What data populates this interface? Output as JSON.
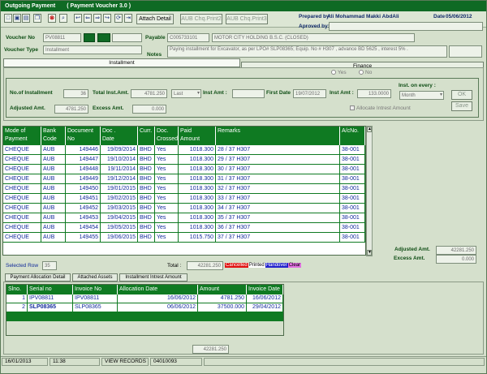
{
  "titlebar": {
    "app": "Outgoing Payment",
    "voucher_kind": "( Payment Voucher 3.0 )"
  },
  "toolbar": {
    "icons": [
      "new-icon",
      "save-icon",
      "print-icon",
      "copy-icon",
      "delete-icon",
      "find-icon",
      "first-icon",
      "previous-icon",
      "next-icon",
      "last-icon",
      "refresh-icon",
      "exit-icon"
    ],
    "attach_detail": "Attach Detail",
    "chq_print_1": "AUB Chq.Print2",
    "chq_print_2": "AUB Chq.Print3"
  },
  "header": {
    "prepared_by_label": "Prepared by:",
    "prepared_by": "Ali Mohammad Makki AbdAli",
    "approved_by_label": "Aproved by:",
    "date_label": "Date",
    "date": "05/06/2012"
  },
  "voucher": {
    "voucher_no_label": "Voucher No",
    "voucher_no": "PV08811",
    "payable_label": "Payable",
    "payable_code": "C005733101",
    "payable_name": "MOTOR CITY HOLDING B.S.C. (CLOSED)",
    "voucher_type_label": "Voucher Type",
    "voucher_type": "Installment",
    "notes_label": "Notes",
    "notes": "Paying installment for Excavator, as per LPO# SLP08365; Equip. No # H307 , advance BD 5625 , interest 5% ."
  },
  "tabs": {
    "installment": "Installment",
    "finance": "Finance"
  },
  "finance": {
    "yes": "Yes",
    "no": "No"
  },
  "installment": {
    "no_of_installment_label": "No.of Installment",
    "no_of_installment": "36",
    "total_inst_amt_label": "Total Inst.Amt.",
    "total_inst_amt": "4781.250",
    "period": "Last",
    "inst_amount_label": "Inst Amt :",
    "first_date_label": "First Date",
    "first_date": "19/07/2012",
    "inst_amt2_label": "Inst Amt :",
    "inst_amt2": "133.0000",
    "inst_every_label": "Inst. on every :",
    "inst_every": "Month",
    "ok": "OK",
    "save": "Save",
    "adjusted_amt_label": "Adjusted Amt.",
    "adjusted_amt": "4781.250",
    "excess_amt_label": "Excess Amt.",
    "excess_amt": "0.000",
    "allocate_interest": "Allocate Intrest Amount"
  },
  "grid": {
    "headers": [
      [
        "Mode of",
        "Payment"
      ],
      [
        "Bank",
        "Code"
      ],
      [
        "Document",
        "No"
      ],
      [
        "Doc .",
        "Date"
      ],
      [
        "Curr.",
        ""
      ],
      [
        "Doc.",
        "Crossed"
      ],
      [
        "Paid",
        "Amount"
      ],
      [
        "Remarks",
        ""
      ],
      [
        "A/cNo.",
        ""
      ]
    ],
    "rows": [
      [
        "CHEQUE",
        "AUB",
        "149446",
        "19/09/2014",
        "BHD",
        "Yes",
        "1018.300",
        "28 / 37 H307",
        "38-001"
      ],
      [
        "CHEQUE",
        "AUB",
        "149447",
        "19/10/2014",
        "BHD",
        "Yes",
        "1018.300",
        "29 / 37 H307",
        "38-001"
      ],
      [
        "CHEQUE",
        "AUB",
        "149448",
        "19/11/2014",
        "BHD",
        "Yes",
        "1018.300",
        "30 / 37 H307",
        "38-001"
      ],
      [
        "CHEQUE",
        "AUB",
        "149449",
        "19/12/2014",
        "BHD",
        "Yes",
        "1018.300",
        "31 / 37 H307",
        "38-001"
      ],
      [
        "CHEQUE",
        "AUB",
        "149450",
        "19/01/2015",
        "BHD",
        "Yes",
        "1018.300",
        "32 / 37 H307",
        "38-001"
      ],
      [
        "CHEQUE",
        "AUB",
        "149451",
        "19/02/2015",
        "BHD",
        "Yes",
        "1018.300",
        "33 / 37 H307",
        "38-001"
      ],
      [
        "CHEQUE",
        "AUB",
        "149452",
        "19/03/2015",
        "BHD",
        "Yes",
        "1018.300",
        "34 / 37 H307",
        "38-001"
      ],
      [
        "CHEQUE",
        "AUB",
        "149453",
        "19/04/2015",
        "BHD",
        "Yes",
        "1018.300",
        "35 / 37 H307",
        "38-001"
      ],
      [
        "CHEQUE",
        "AUB",
        "149454",
        "19/05/2015",
        "BHD",
        "Yes",
        "1018.300",
        "36 / 37 H307",
        "38-001"
      ],
      [
        "CHEQUE",
        "AUB",
        "149455",
        "19/06/2015",
        "BHD",
        "Yes",
        "1015.750",
        "37 / 37 H307",
        "38-001"
      ]
    ]
  },
  "totals": {
    "adjusted_amt_label": "Adjusted Amt.",
    "adjusted_amt": "42281.250",
    "excess_amt_label": "Excess Amt.",
    "excess_amt": "0.000",
    "selected_row_label": "Selected Row",
    "selected_row": "35",
    "total_label": "Total :",
    "total": "42281.250",
    "legend_cancelled": "Cancelled",
    "legend_printed": "Printed",
    "legend_handover": "Handover",
    "legend_clear": "Clear"
  },
  "bottom_tabs": [
    "Payment Allocation Detail",
    "Attached Assets",
    "Installment Intrest Amount"
  ],
  "allocation": {
    "headers": [
      "Slno.",
      "Serial no",
      "Invoice No",
      "Allocation Date",
      "Amount",
      "Invoice Date"
    ],
    "rows": [
      [
        "1",
        "IPV08811",
        "IPV08811",
        "16/06/2012",
        "4781.250",
        "16/06/2012"
      ],
      [
        "2",
        "SLP08365",
        "SLP08365",
        "06/06/2012",
        "37500.000",
        "29/04/2012"
      ]
    ],
    "footer_total": "42281.250"
  },
  "status": {
    "date": "16/01/2013",
    "time": "11:38",
    "mode": "VIEW RECORDS",
    "code": "04010093"
  },
  "colors": {
    "accent": "#0f7a22",
    "text_blue": "#102a9a",
    "cancelled": "#e01010",
    "handover": "#2222cc",
    "clear": "#e070e0"
  }
}
